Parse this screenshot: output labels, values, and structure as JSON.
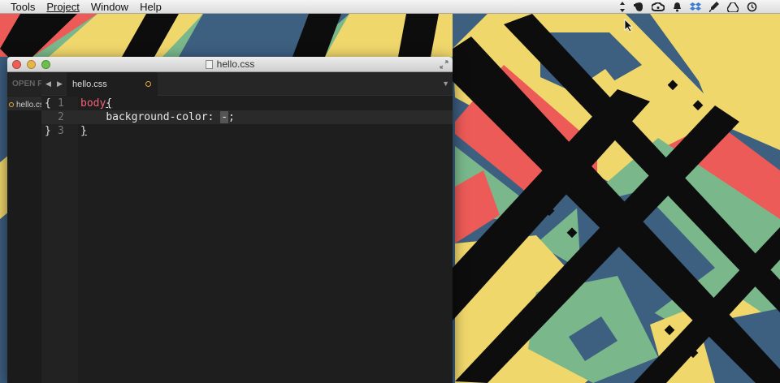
{
  "menubar": {
    "items": [
      "Tools",
      "Project",
      "Window",
      "Help"
    ],
    "status_icons": [
      "sync-icon",
      "evernote-icon",
      "creative-cloud-icon",
      "notification-bell-icon",
      "dropbox-icon",
      "pen-icon",
      "google-drive-icon",
      "time-machine-icon"
    ]
  },
  "window": {
    "title": "hello.css",
    "sidebar_header": "OPEN F",
    "tab_label": "hello.css",
    "sidebar_file": "hello.css",
    "nav_back": "◀",
    "nav_forward": "▶",
    "dropdown_glyph": "▼"
  },
  "editor": {
    "lines": [
      {
        "number": "1",
        "fold": "{",
        "selector": "body",
        "brace": "{"
      },
      {
        "number": "2",
        "fold": "",
        "property": "background-color: ",
        "value": "-",
        "end": ";"
      },
      {
        "number": "3",
        "fold": "}",
        "brace": "}"
      }
    ]
  },
  "colors": {
    "wall_red": "#ec5b57",
    "wall_yellow": "#f0d76c",
    "wall_green": "#7ab88c",
    "wall_blue": "#3d5f80",
    "wall_black": "#0d0d0d",
    "selector_pink": "#f4617a",
    "modified_dot": "#e6a93a"
  }
}
